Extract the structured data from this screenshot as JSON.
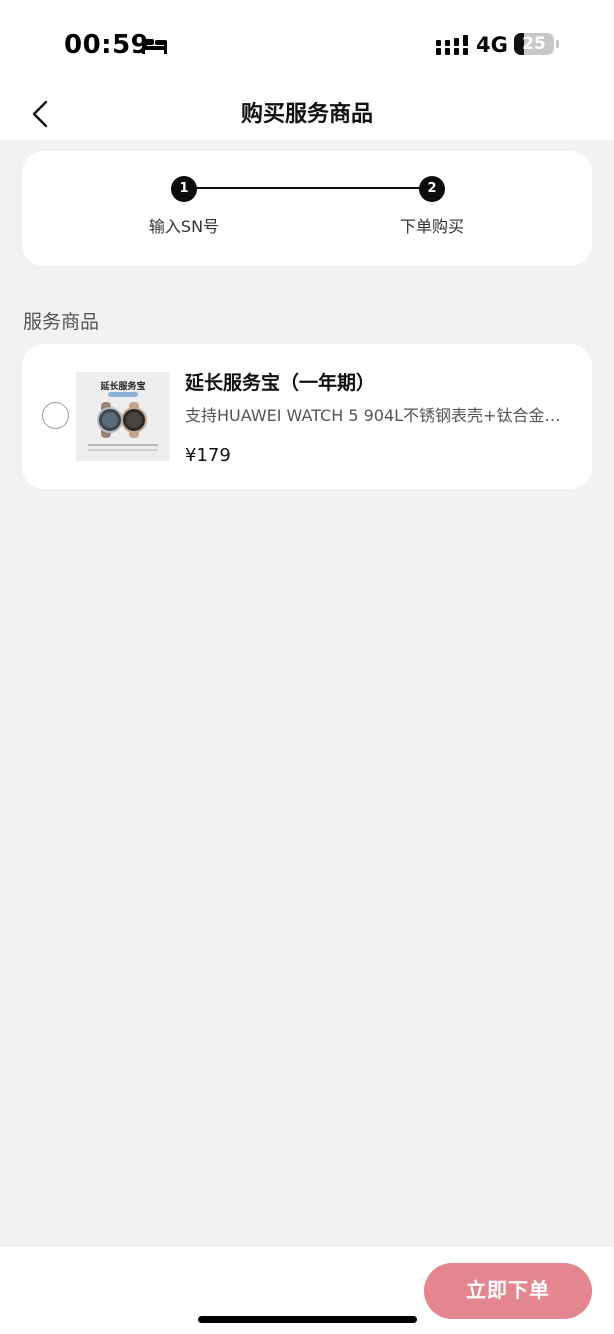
{
  "status_bar": {
    "time": "00:59",
    "network": "4G",
    "battery_level": "25",
    "battery_fraction": 0.25
  },
  "nav": {
    "title": "购买服务商品"
  },
  "steps": [
    {
      "number": "1",
      "label": "输入SN号"
    },
    {
      "number": "2",
      "label": "下单购买"
    }
  ],
  "section": {
    "title": "服务商品"
  },
  "product": {
    "name": "延长服务宝（一年期）",
    "description": "支持HUAWEI WATCH 5 904L不锈钢表壳+钛合金…",
    "price": "¥179",
    "selected": false,
    "thumbnail_title": "延长服务宝"
  },
  "footer": {
    "order_button": "立即下单"
  },
  "colors": {
    "accent": "#e3868f",
    "background": "#f1f2f4"
  }
}
